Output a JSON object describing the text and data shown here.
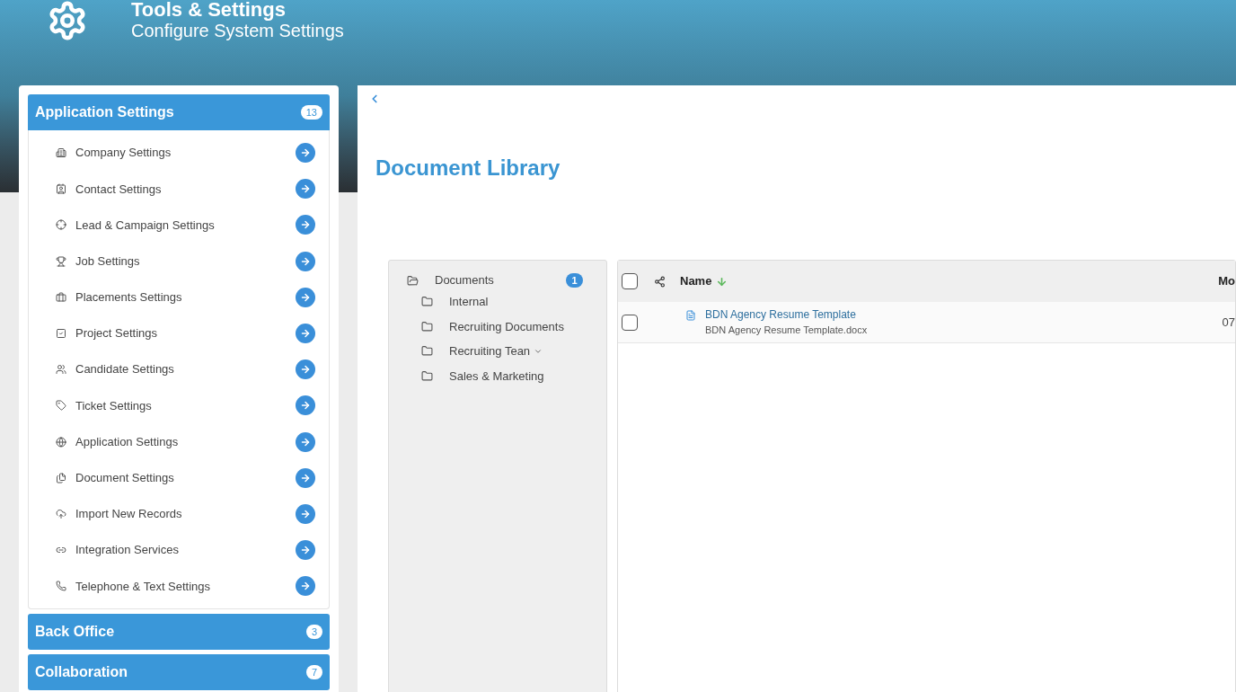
{
  "header": {
    "title": "Tools & Settings",
    "subtitle": "Configure System Settings"
  },
  "sidebar": {
    "sections": [
      {
        "title": "Application Settings",
        "count": "13",
        "expanded": true,
        "items": [
          {
            "label": "Company Settings"
          },
          {
            "label": "Contact Settings"
          },
          {
            "label": "Lead & Campaign Settings"
          },
          {
            "label": "Job Settings"
          },
          {
            "label": "Placements Settings"
          },
          {
            "label": "Project Settings"
          },
          {
            "label": "Candidate Settings"
          },
          {
            "label": "Ticket Settings"
          },
          {
            "label": "Application Settings"
          },
          {
            "label": "Document Settings"
          },
          {
            "label": "Import New Records"
          },
          {
            "label": "Integration Services"
          },
          {
            "label": "Telephone & Text Settings"
          }
        ]
      },
      {
        "title": "Back Office",
        "count": "3",
        "expanded": false
      },
      {
        "title": "Collaboration",
        "count": "7",
        "expanded": false
      }
    ]
  },
  "main": {
    "title": "Document Library",
    "tree": {
      "label": "Documents",
      "count": "1",
      "children": [
        {
          "label": "Internal",
          "expandable": false
        },
        {
          "label": "Recruiting Documents",
          "expandable": false
        },
        {
          "label": "Recruiting Tean",
          "expandable": true
        },
        {
          "label": "Sales & Marketing",
          "expandable": false
        }
      ]
    },
    "table": {
      "columns": [
        {
          "label": "Name",
          "sorted": true
        },
        {
          "label": "Mo",
          "sorted": false
        }
      ],
      "rows": [
        {
          "title": "BDN Agency Resume Template",
          "file": "BDN Agency Resume Template.docx",
          "column_2": "07",
          "checked": false
        }
      ],
      "all_checked": false
    }
  }
}
